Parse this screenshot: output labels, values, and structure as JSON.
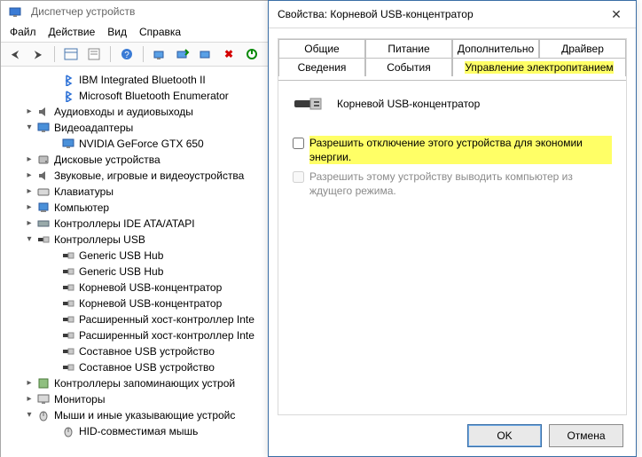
{
  "dm": {
    "title": "Диспетчер устройств",
    "menu": [
      "Файл",
      "Действие",
      "Вид",
      "Справка"
    ],
    "tree": [
      {
        "lvl": 2,
        "ic": "bt",
        "t": "IBM Integrated Bluetooth II"
      },
      {
        "lvl": 2,
        "ic": "bt",
        "t": "Microsoft Bluetooth Enumerator"
      },
      {
        "lvl": 1,
        "exp": "▸",
        "ic": "audio",
        "t": "Аудиовходы и аудиовыходы"
      },
      {
        "lvl": 1,
        "exp": "▾",
        "ic": "display",
        "t": "Видеоадаптеры"
      },
      {
        "lvl": 2,
        "ic": "display",
        "t": "NVIDIA GeForce GTX 650"
      },
      {
        "lvl": 1,
        "exp": "▸",
        "ic": "disk",
        "t": "Дисковые устройства"
      },
      {
        "lvl": 1,
        "exp": "▸",
        "ic": "audio",
        "t": "Звуковые, игровые и видеоустройства"
      },
      {
        "lvl": 1,
        "exp": "▸",
        "ic": "kb",
        "t": "Клавиатуры"
      },
      {
        "lvl": 1,
        "exp": "▸",
        "ic": "pc",
        "t": "Компьютер"
      },
      {
        "lvl": 1,
        "exp": "▸",
        "ic": "ide",
        "t": "Контроллеры IDE ATA/ATAPI"
      },
      {
        "lvl": 1,
        "exp": "▾",
        "ic": "usb",
        "t": "Контроллеры USB"
      },
      {
        "lvl": 2,
        "ic": "usb",
        "t": "Generic USB Hub"
      },
      {
        "lvl": 2,
        "ic": "usb",
        "t": "Generic USB Hub"
      },
      {
        "lvl": 2,
        "ic": "usb",
        "t": "Корневой USB-концентратор"
      },
      {
        "lvl": 2,
        "ic": "usb",
        "t": "Корневой USB-концентратор"
      },
      {
        "lvl": 2,
        "ic": "usb",
        "t": "Расширенный хост-контроллер Inte"
      },
      {
        "lvl": 2,
        "ic": "usb",
        "t": "Расширенный хост-контроллер Inte"
      },
      {
        "lvl": 2,
        "ic": "usb",
        "t": "Составное USB устройство"
      },
      {
        "lvl": 2,
        "ic": "usb",
        "t": "Составное USB устройство"
      },
      {
        "lvl": 1,
        "exp": "▸",
        "ic": "storage",
        "t": "Контроллеры запоминающих устрой"
      },
      {
        "lvl": 1,
        "exp": "▸",
        "ic": "monitor",
        "t": "Мониторы"
      },
      {
        "lvl": 1,
        "exp": "▾",
        "ic": "mouse",
        "t": "Мыши и иные указывающие устройс"
      },
      {
        "lvl": 2,
        "ic": "mouse",
        "t": "HID-совместимая мышь"
      }
    ]
  },
  "dlg": {
    "title": "Свойства: Корневой USB-концентратор",
    "tabs_top": [
      "Общие",
      "Питание",
      "Дополнительно",
      "Драйвер"
    ],
    "tabs_bottom": [
      "Сведения",
      "События",
      "Управление электропитанием"
    ],
    "tab_selected": "Управление электропитанием",
    "device_name": "Корневой USB-концентратор",
    "opt1": "Разрешить отключение этого устройства для экономии энергии.",
    "opt2": "Разрешить этому устройству выводить компьютер из ждущего режима.",
    "ok": "OK",
    "cancel": "Отмена"
  }
}
